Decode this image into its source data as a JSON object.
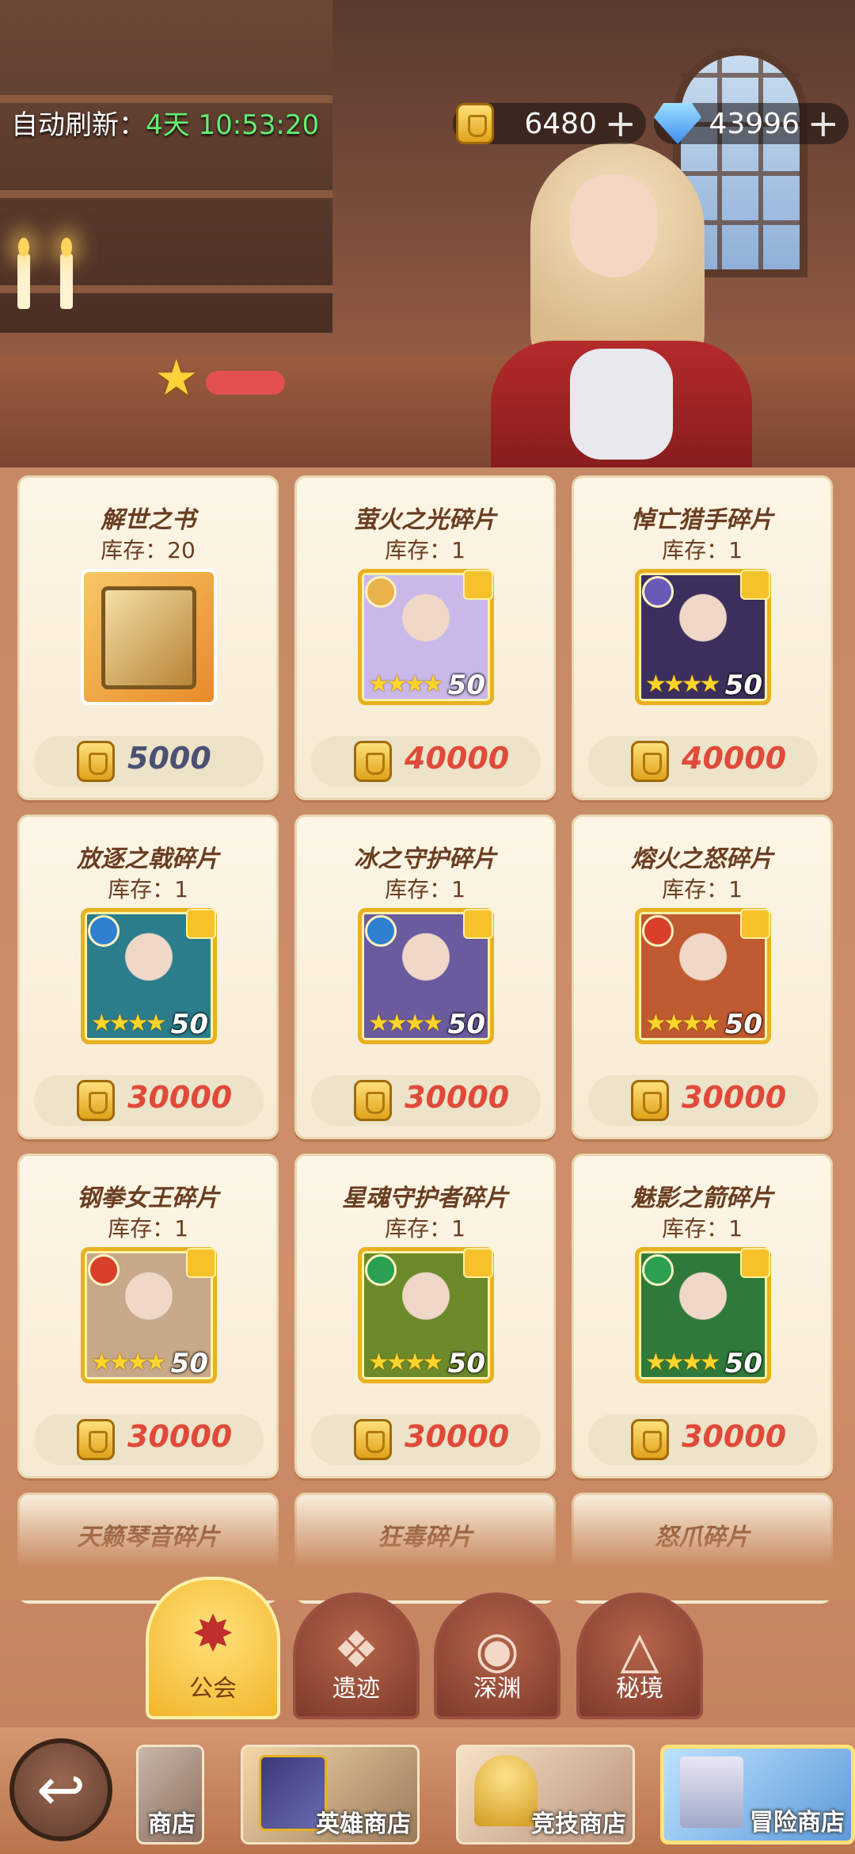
{
  "header": {
    "refresh_label": "自动刷新：",
    "refresh_time": "4天 10:53:20",
    "gold_amount": "6480",
    "gem_amount": "43996",
    "plus_symbol": "+"
  },
  "colors": {
    "price_expensive": "#e04a3a",
    "price_cheap": "#4b5172",
    "timer_green": "#62ef72",
    "card_bg": "#fdf6e6"
  },
  "items": [
    {
      "name": "解世之书",
      "stock": "库存：20",
      "price": "5000",
      "type": "book"
    },
    {
      "name": "萤火之光碎片",
      "stock": "库存：1",
      "price": "40000",
      "level": "50",
      "stars": "★★★★",
      "badge_color": "#e9b24a",
      "art": "#c9b8e8"
    },
    {
      "name": "悼亡猎手碎片",
      "stock": "库存：1",
      "price": "40000",
      "level": "50",
      "stars": "★★★★",
      "badge_color": "#6a5ab8",
      "art": "#3c2f5e"
    },
    {
      "name": "放逐之戟碎片",
      "stock": "库存：1",
      "price": "30000",
      "level": "50",
      "stars": "★★★★",
      "badge_color": "#2f80d0",
      "art": "#2b7d8c"
    },
    {
      "name": "冰之守护碎片",
      "stock": "库存：1",
      "price": "30000",
      "level": "50",
      "stars": "★★★★",
      "badge_color": "#2f80d0",
      "art": "#6a5a9e"
    },
    {
      "name": "熔火之怒碎片",
      "stock": "库存：1",
      "price": "30000",
      "level": "50",
      "stars": "★★★★",
      "badge_color": "#d8402a",
      "art": "#c05a30"
    },
    {
      "name": "钢拳女王碎片",
      "stock": "库存：1",
      "price": "30000",
      "level": "50",
      "stars": "★★★★",
      "badge_color": "#d8402a",
      "art": "#c7a888"
    },
    {
      "name": "星魂守护者碎片",
      "stock": "库存：1",
      "price": "30000",
      "level": "50",
      "stars": "★★★★",
      "badge_color": "#2aa050",
      "art": "#6c8a2a"
    },
    {
      "name": "魅影之箭碎片",
      "stock": "库存：1",
      "price": "30000",
      "level": "50",
      "stars": "★★★★",
      "badge_color": "#2aa050",
      "art": "#2f7a3a"
    },
    {
      "name": "天籁琴音碎片"
    },
    {
      "name": "狂毒碎片"
    },
    {
      "name": "怒爪碎片"
    }
  ],
  "tabs": [
    {
      "label": "公会",
      "icon": "guild-banner-icon",
      "glyph": "✸",
      "active": true
    },
    {
      "label": "遗迹",
      "icon": "relic-shield-icon",
      "glyph": "❖",
      "active": false
    },
    {
      "label": "深渊",
      "icon": "abyss-eye-icon",
      "glyph": "◉",
      "active": false
    },
    {
      "label": "秘境",
      "icon": "secret-realm-triangle-icon",
      "glyph": "△",
      "active": false
    }
  ],
  "shops": [
    {
      "label": "商店",
      "name": "partial-shop"
    },
    {
      "label": "英雄商店",
      "name": "hero-shop"
    },
    {
      "label": "竞技商店",
      "name": "arena-shop"
    },
    {
      "label": "冒险商店",
      "name": "adventure-shop"
    }
  ],
  "back_glyph": "↩"
}
